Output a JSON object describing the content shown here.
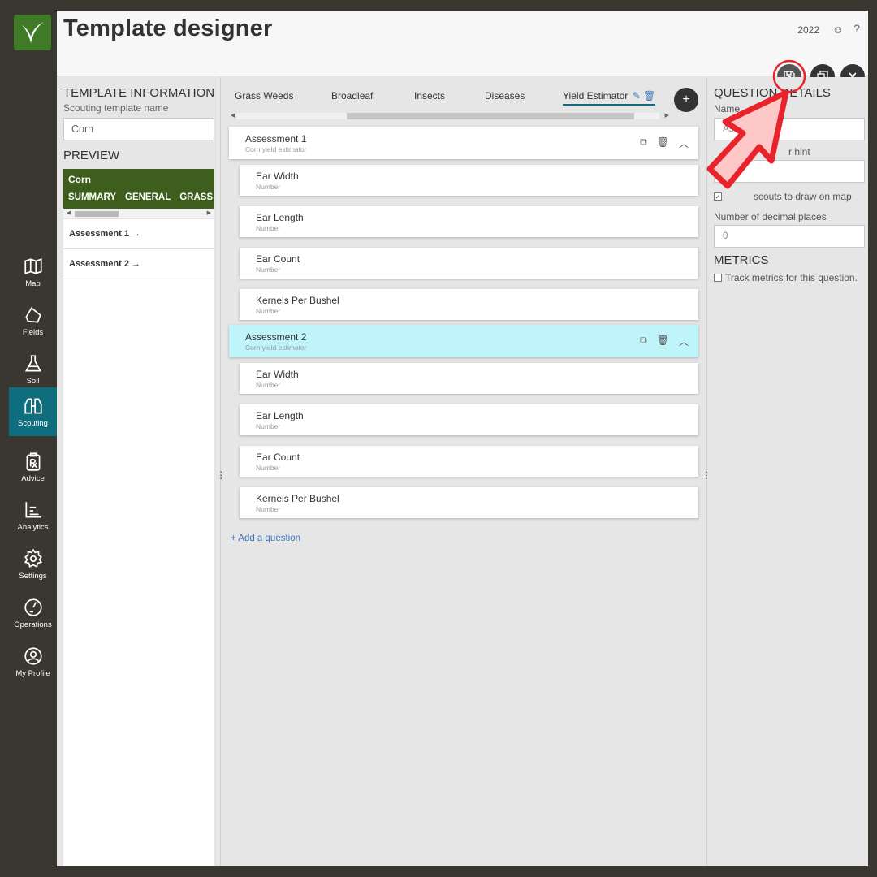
{
  "header": {
    "title": "Template designer",
    "year": "2022",
    "smile_icon": "☺",
    "help_icon": "?"
  },
  "nav": {
    "items": [
      {
        "label": "Map",
        "icon": "map-icon"
      },
      {
        "label": "Fields",
        "icon": "field-icon"
      },
      {
        "label": "Soil",
        "icon": "flask-icon"
      },
      {
        "label": "Scouting",
        "icon": "binoculars-icon",
        "active": true
      },
      {
        "label": "Advice",
        "icon": "prescription-icon"
      },
      {
        "label": "Analytics",
        "icon": "chart-icon"
      },
      {
        "label": "Settings",
        "icon": "gear-icon"
      },
      {
        "label": "Operations",
        "icon": "gauge-icon"
      },
      {
        "label": "My Profile",
        "icon": "user-icon"
      }
    ]
  },
  "template_info": {
    "title": "TEMPLATE INFORMATION",
    "name_label": "Scouting template name",
    "name_value": "Corn",
    "preview_title": "PREVIEW",
    "preview": {
      "crop": "Corn",
      "tabs": [
        "SUMMARY",
        "GENERAL",
        "GRASS W"
      ],
      "items": [
        "Assessment 1 →",
        "Assessment 2 →"
      ]
    }
  },
  "designer": {
    "tabs": [
      "Grass Weeds",
      "Broadleaf",
      "Insects",
      "Diseases",
      "Yield Estimator"
    ],
    "active_tab": "Yield Estimator",
    "add_tab": "+",
    "assessments": [
      {
        "name": "Assessment 1",
        "sub": "Corn yield estimator",
        "questions": [
          {
            "name": "Ear Width",
            "type": "Number"
          },
          {
            "name": "Ear Length",
            "type": "Number"
          },
          {
            "name": "Ear Count",
            "type": "Number"
          },
          {
            "name": "Kernels Per Bushel",
            "type": "Number"
          }
        ]
      },
      {
        "name": "Assessment 2",
        "sub": "Corn yield estimator",
        "selected": true,
        "questions": [
          {
            "name": "Ear Width",
            "type": "Number"
          },
          {
            "name": "Ear Length",
            "type": "Number"
          },
          {
            "name": "Ear Count",
            "type": "Number"
          },
          {
            "name": "Kernels Per Bushel",
            "type": "Number"
          }
        ]
      }
    ],
    "add_question": "+  Add a question"
  },
  "details": {
    "title": "QUESTION DETAILS",
    "name_label": "Name",
    "name_value": "Ass",
    "hint_label": "r hint",
    "draw_label": "scouts to draw on map",
    "decimals_label": "Number of decimal places",
    "decimals_value": "0",
    "metrics_title": "METRICS",
    "metrics_label": "Track metrics for this question."
  },
  "colors": {
    "nav_bg": "#3a3630",
    "active_nav": "#0f6e7d",
    "preview_header": "#3e5e1e",
    "selected_assessment": "#bff4fb",
    "link": "#3b76b8",
    "annotation_red": "#e8232b"
  }
}
